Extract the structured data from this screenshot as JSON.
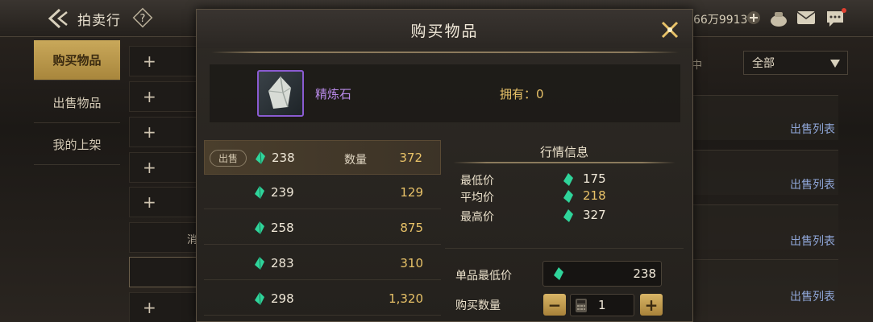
{
  "topbar": {
    "title": "拍卖行",
    "currency": "66万9913",
    "icons": [
      "back-arrow-icon",
      "help-icon",
      "plus-icon",
      "bag-icon",
      "mail-icon",
      "chat-icon"
    ]
  },
  "sidebar": {
    "tabs": [
      {
        "label": "购买物品",
        "active": true
      },
      {
        "label": "出售物品",
        "active": false
      },
      {
        "label": "我的上架",
        "active": false
      }
    ],
    "plus_label": "+",
    "fragment_label": "消"
  },
  "filter": {
    "selected": "全部",
    "fragment": "中"
  },
  "sell_list_label": "出售列表",
  "dialog": {
    "title": "购买物品",
    "item": {
      "name": "精炼石",
      "owned_label": "拥有：0"
    },
    "listings": [
      {
        "badge": "出售",
        "price": "238",
        "qty_label": "数量",
        "qty": "372",
        "selected": true
      },
      {
        "badge": "",
        "price": "239",
        "qty_label": "",
        "qty": "129",
        "selected": false
      },
      {
        "badge": "",
        "price": "258",
        "qty_label": "",
        "qty": "875",
        "selected": false
      },
      {
        "badge": "",
        "price": "283",
        "qty_label": "",
        "qty": "310",
        "selected": false
      },
      {
        "badge": "",
        "price": "298",
        "qty_label": "",
        "qty": "1,320",
        "selected": false
      }
    ],
    "market": {
      "title": "行情信息",
      "rows": [
        {
          "label": "最低价",
          "value": "175",
          "color": "#f0e8d8"
        },
        {
          "label": "平均价",
          "value": "218",
          "color": "#e8c268"
        },
        {
          "label": "最高价",
          "value": "327",
          "color": "#f0e8d8"
        }
      ]
    },
    "min_price_label": "单品最低价",
    "min_price_value": "238",
    "buy_qty_label": "购买数量",
    "buy_qty_value": "1",
    "minus_label": "−",
    "plus_label": "+"
  },
  "colors": {
    "gold_accent": "#c9a85a",
    "purple_rarity": "#8a5bd1",
    "gem_green": "#2fd49a",
    "link_blue": "#8fa6d8"
  }
}
